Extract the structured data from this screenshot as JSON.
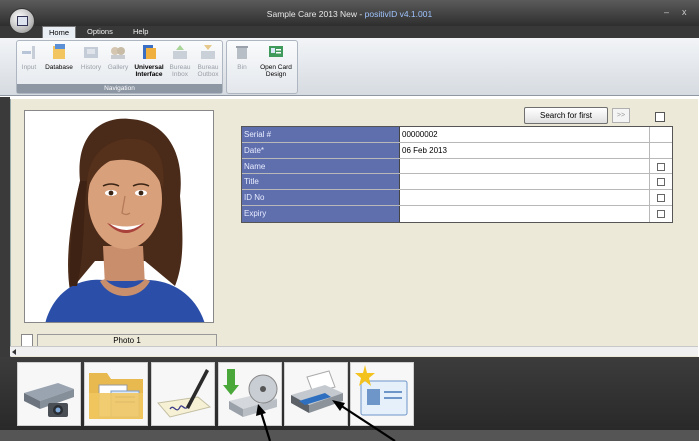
{
  "window": {
    "title": "Sample Care 2013 New",
    "separator": " - ",
    "product": "positivID v4.1.001",
    "minimize": "–",
    "close": "x"
  },
  "tabs": [
    {
      "label": "Home",
      "active": true
    },
    {
      "label": "Options",
      "active": false
    },
    {
      "label": "Help",
      "active": false
    }
  ],
  "ribbon": {
    "navigation_group": "Navigation",
    "buttons": [
      {
        "label": "Input",
        "label2": "",
        "icon": "input-icon",
        "enabled": false
      },
      {
        "label": "Database",
        "label2": "",
        "icon": "database-icon",
        "enabled": true
      },
      {
        "label": "History",
        "label2": "",
        "icon": "history-icon",
        "enabled": false
      },
      {
        "label": "Gallery",
        "label2": "",
        "icon": "gallery-icon",
        "enabled": false
      },
      {
        "label": "Universal",
        "label2": "Interface",
        "icon": "universal-interface-icon",
        "enabled": true
      },
      {
        "label": "Bureau",
        "label2": "Inbox",
        "icon": "bureau-inbox-icon",
        "enabled": false
      },
      {
        "label": "Bureau",
        "label2": "Outbox",
        "icon": "bureau-outbox-icon",
        "enabled": false
      }
    ],
    "second_group": [
      {
        "label": "Bin",
        "label2": "",
        "icon": "bin-icon",
        "enabled": false
      },
      {
        "label": "Open Card",
        "label2": "Design",
        "icon": "card-design-icon",
        "enabled": true
      }
    ]
  },
  "search": {
    "button_label": "Search for first",
    "next_label": ">>"
  },
  "record_fields": [
    {
      "label": "Serial #",
      "value": "00000002",
      "checkbox": false
    },
    {
      "label": "Date*",
      "value": "06 Feb 2013",
      "checkbox": false
    },
    {
      "label": "Name",
      "value": "",
      "checkbox": true
    },
    {
      "label": "Title",
      "value": "",
      "checkbox": true
    },
    {
      "label": "ID No",
      "value": "",
      "checkbox": true
    },
    {
      "label": "Expiry",
      "value": "",
      "checkbox": true
    }
  ],
  "photo": {
    "caption": "Photo 1"
  },
  "bottom_toolbar": [
    {
      "name": "scanner-icon"
    },
    {
      "name": "folder-documents-icon"
    },
    {
      "name": "signature-pad-icon"
    },
    {
      "name": "save-to-disk-icon"
    },
    {
      "name": "printer-icon"
    },
    {
      "name": "new-card-icon"
    }
  ],
  "colors": {
    "field_label_bg": "#5f6fae",
    "title_version": "#9fc4ff",
    "workspace_bg": "#ece9d8"
  }
}
